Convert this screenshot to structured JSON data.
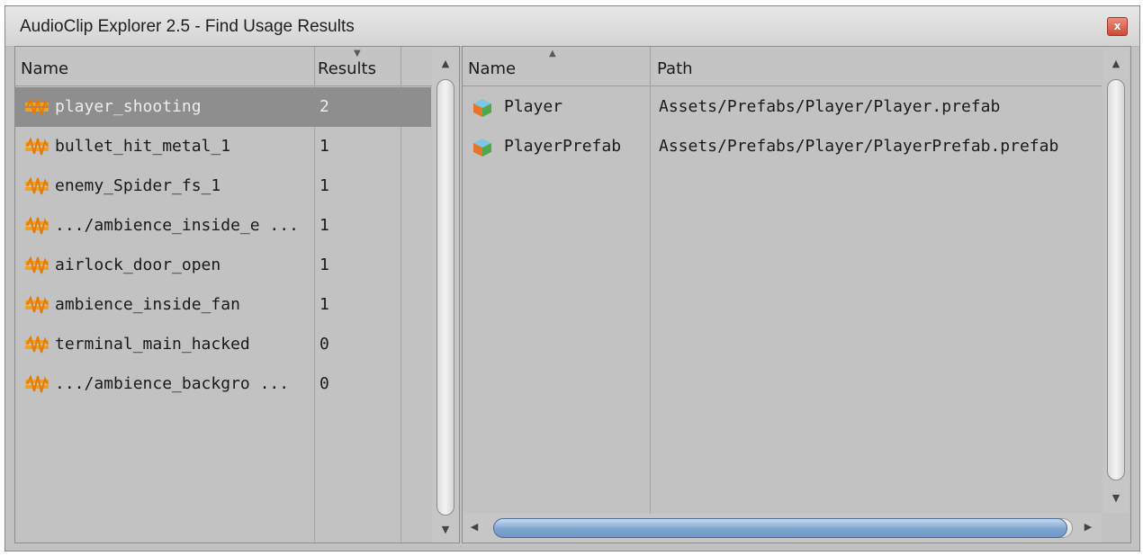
{
  "window": {
    "title": "AudioClip Explorer 2.5 - Find Usage Results",
    "close_label": "x"
  },
  "left_table": {
    "headers": {
      "name": "Name",
      "results": "Results"
    },
    "rows": [
      {
        "name": "player_shooting",
        "results": "2",
        "selected": true
      },
      {
        "name": "bullet_hit_metal_1",
        "results": "1"
      },
      {
        "name": "enemy_Spider_fs_1",
        "results": "1"
      },
      {
        "name": ".../ambience_inside_e ...",
        "results": "1"
      },
      {
        "name": "airlock_door_open",
        "results": "1"
      },
      {
        "name": "ambience_inside_fan",
        "results": "1"
      },
      {
        "name": "terminal_main_hacked",
        "results": "0"
      },
      {
        "name": ".../ambience_backgro ...",
        "results": "0"
      }
    ]
  },
  "right_table": {
    "headers": {
      "name": "Name",
      "path": "Path"
    },
    "rows": [
      {
        "name": "Player",
        "path": "Assets/Prefabs/Player/Player.prefab"
      },
      {
        "name": "PlayerPrefab",
        "path": "Assets/Prefabs/Player/PlayerPrefab.prefab"
      }
    ]
  },
  "icons": {
    "row_left": "audio-clip-icon",
    "row_right": "prefab-cube-icon",
    "close": "close-icon"
  },
  "colors": {
    "selected_row": "#8e8e8e",
    "scroll_thumb": "#7fa4cf"
  }
}
